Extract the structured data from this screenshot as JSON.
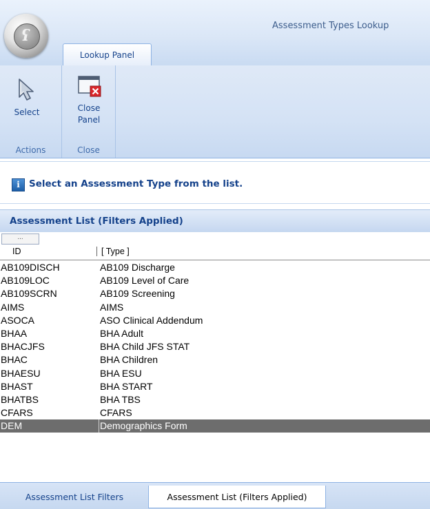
{
  "app": {
    "title": "Assessment Types Lookup"
  },
  "ribbon": {
    "tab_label": "Lookup Panel",
    "buttons": {
      "select_label": "Select",
      "close_label": "Close Panel"
    },
    "groups": {
      "actions": "Actions",
      "close": "Close"
    }
  },
  "info": {
    "message": "Select an Assessment Type from the list."
  },
  "list": {
    "header": "Assessment List (Filters Applied)",
    "filter_placeholder": "...",
    "columns": {
      "id": "ID",
      "type": "[ Type ]"
    },
    "rows": [
      {
        "id": "AB109DISCH",
        "type": "AB109 Discharge"
      },
      {
        "id": "AB109LOC",
        "type": "AB109 Level of Care"
      },
      {
        "id": "AB109SCRN",
        "type": "AB109 Screening"
      },
      {
        "id": "AIMS",
        "type": "AIMS"
      },
      {
        "id": "ASOCA",
        "type": "ASO Clinical Addendum"
      },
      {
        "id": "BHAA",
        "type": "BHA Adult"
      },
      {
        "id": "BHACJFS",
        "type": "BHA Child JFS STAT"
      },
      {
        "id": "BHAC",
        "type": "BHA Children"
      },
      {
        "id": "BHAESU",
        "type": "BHA ESU"
      },
      {
        "id": "BHAST",
        "type": "BHA START"
      },
      {
        "id": "BHATBS",
        "type": "BHA TBS"
      },
      {
        "id": "CFARS",
        "type": "CFARS"
      },
      {
        "id": "DEM",
        "type": "Demographics Form"
      }
    ],
    "selected_index": 12
  },
  "bottom_tabs": [
    {
      "label": "Assessment List Filters"
    },
    {
      "label": "Assessment List (Filters Applied)"
    }
  ],
  "colors": {
    "accent": "#15428b",
    "ribbon_bg": "#d4e2f5",
    "selected_row": "#6d6d6d",
    "close_icon_red": "#d9262b"
  }
}
